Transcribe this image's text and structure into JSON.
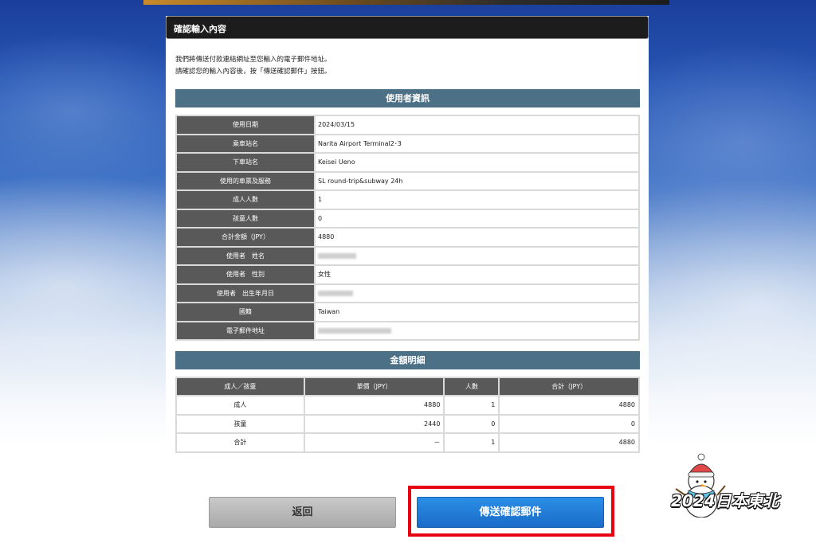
{
  "header": {
    "title": "確認輸入內容"
  },
  "intro": {
    "line1": "我們將傳送付款連結網址至您輸入的電子郵件地址。",
    "line2": "請確認您的輸入內容後，按「傳送確認郵件」按鈕。"
  },
  "user_info": {
    "title": "使用者資訊",
    "rows": [
      {
        "label": "使用日期",
        "value": "2024/03/15"
      },
      {
        "label": "乘車站名",
        "value": "Narita Airport Terminal2･3"
      },
      {
        "label": "下車站名",
        "value": "Keisei Ueno"
      },
      {
        "label": "使用的車票及服務",
        "value": "SL round-trip&subway 24h"
      },
      {
        "label": "成人人數",
        "value": "1"
      },
      {
        "label": "孩童人數",
        "value": "0"
      },
      {
        "label": "合計金額（JPY）",
        "value": "4880"
      },
      {
        "label": "使用者　姓名",
        "value": ""
      },
      {
        "label": "使用者　性別",
        "value": "女性"
      },
      {
        "label": "使用者　出生年月日",
        "value": ""
      },
      {
        "label": "國籍",
        "value": "Taiwan"
      },
      {
        "label": "電子郵件地址",
        "value": ""
      }
    ]
  },
  "amount": {
    "title": "金額明細",
    "headers": [
      "成人／孩童",
      "單價（JPY）",
      "人數",
      "合計（JPY）"
    ],
    "rows": [
      [
        "成人",
        "4880",
        "1",
        "4880"
      ],
      [
        "孩童",
        "2440",
        "0",
        "0"
      ],
      [
        "合計",
        "－",
        "1",
        "4880"
      ]
    ]
  },
  "buttons": {
    "back": "返回",
    "send": "傳送確認郵件"
  },
  "watermark": {
    "text": "2024日本東北"
  },
  "colors": {
    "section": "#4c7186",
    "label_cell": "#595959",
    "send_button": "#1a6cc8",
    "highlight": "#e60012"
  }
}
